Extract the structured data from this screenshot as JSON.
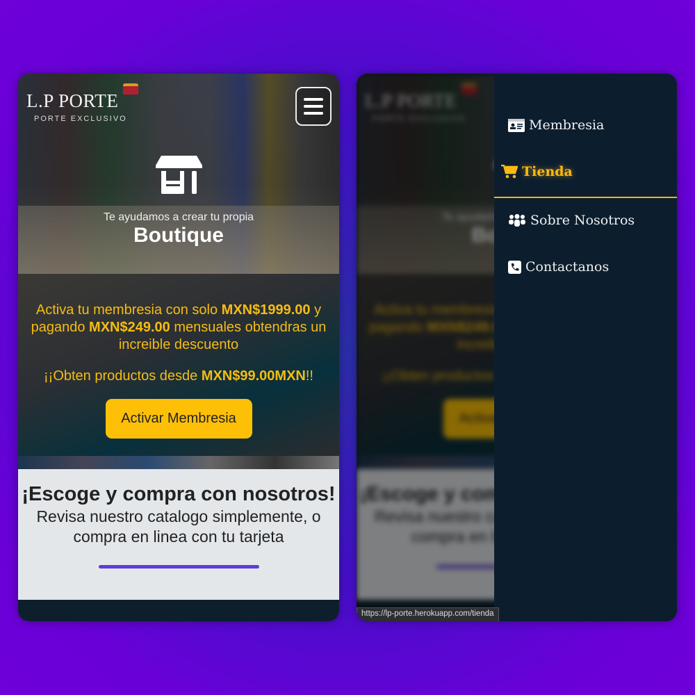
{
  "logo": {
    "name": "L.P PORTE",
    "tagline": "PORTE EXCLUSIVO"
  },
  "hero": {
    "subtitle": "Te ayudamos a crear tu propia",
    "title": "Boutique",
    "icon": "store-icon"
  },
  "promo": {
    "line1_a": "Activa tu membresia con solo ",
    "price_membership": "MXN$1999.00",
    "line1_b": " y pagando ",
    "price_monthly": "MXN$249.00",
    "line1_c": " mensuales obtendras un increible descuento",
    "line2_a": "¡¡Obten productos desde ",
    "price_from": "MXN$99.00MXN",
    "line2_b": "!!",
    "button": "Activar Membresia"
  },
  "catalog": {
    "title": "¡Escoge y compra con nosotros!",
    "text": "Revisa nuestro catalogo simplemente, o compra en linea con tu tarjeta"
  },
  "sidebar": {
    "items": [
      {
        "label": "Membresia",
        "icon": "id-card-icon"
      },
      {
        "label": "Tienda",
        "icon": "cart-icon",
        "active": true
      },
      {
        "label": "Sobre Nosotros",
        "icon": "users-icon"
      },
      {
        "label": "Contactanos",
        "icon": "phone-icon"
      }
    ]
  },
  "status_url": "https://lp-porte.herokuapp.com/tienda",
  "colors": {
    "accent": "#fec007",
    "sidebar": "#0c1e2e",
    "divider": "#5b3fd6",
    "background": "#6a00d8"
  }
}
